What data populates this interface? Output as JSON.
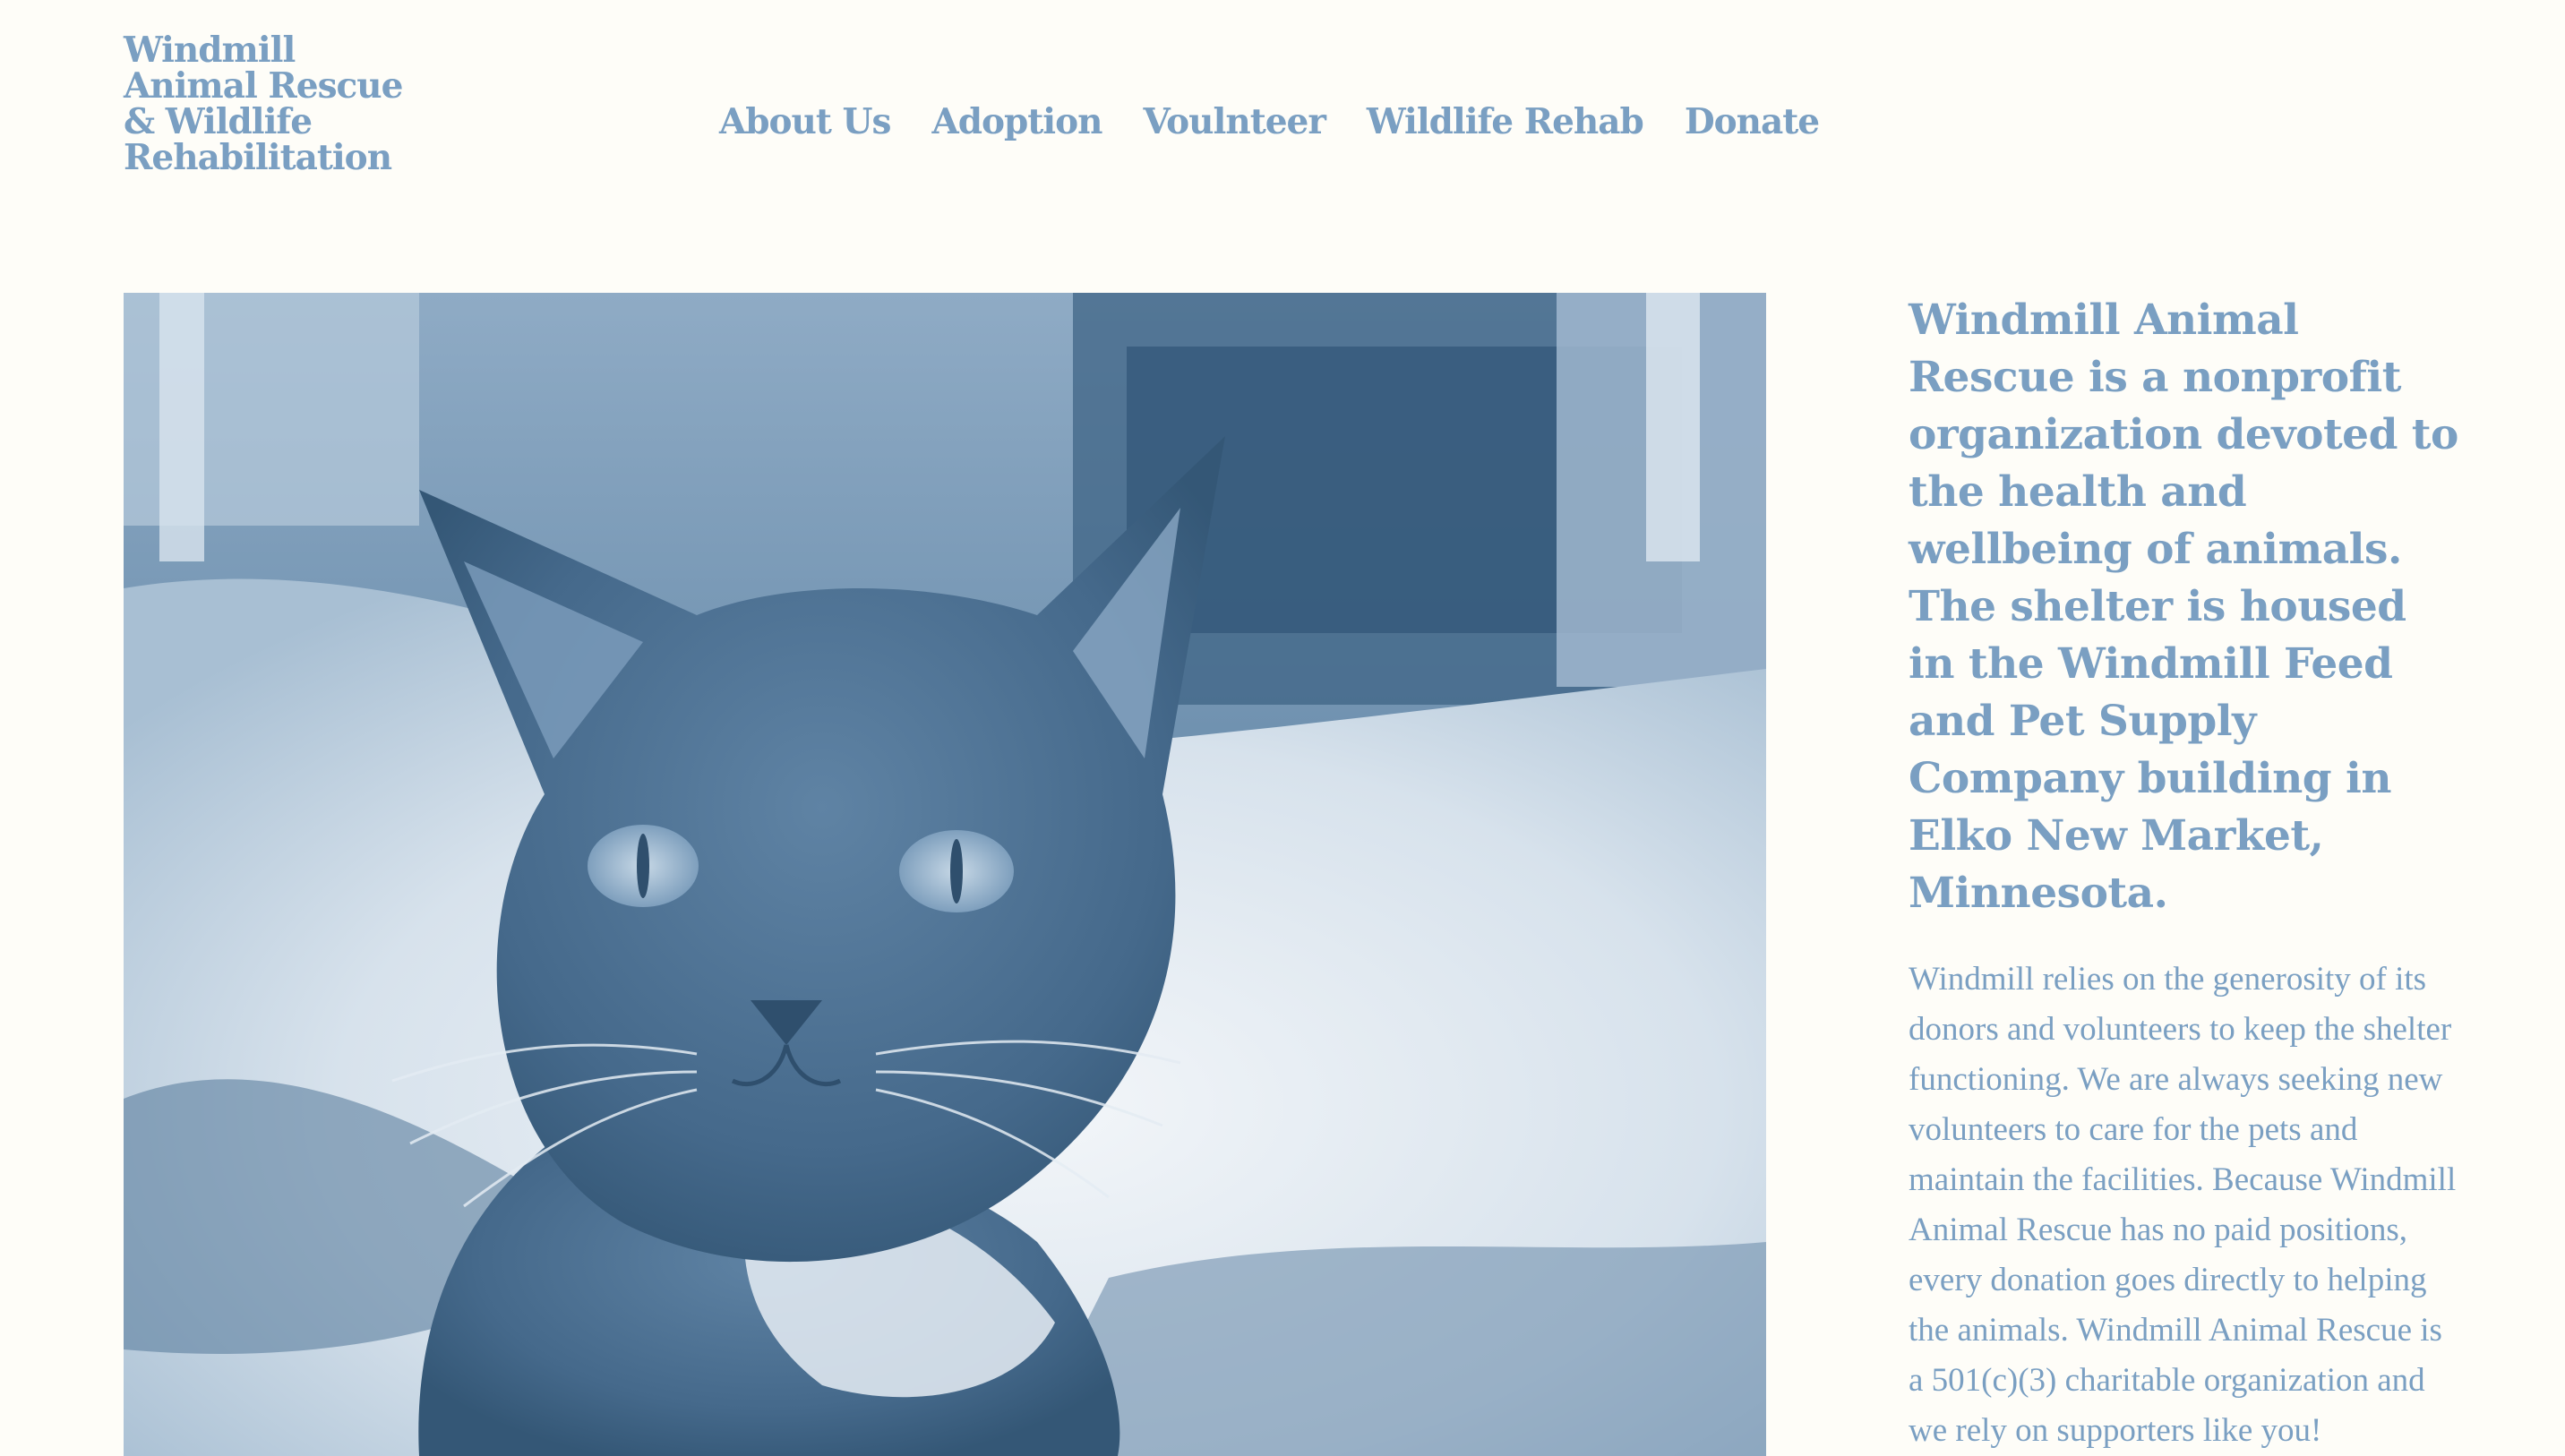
{
  "colors": {
    "background": "#fefdf8",
    "accent": "#7a9fc2",
    "photo_tint": "#4f7596"
  },
  "header": {
    "site_title_lines": [
      "Windmill",
      "Animal Rescue",
      "& Wildlife",
      "Rehabilitation"
    ]
  },
  "nav": {
    "items": [
      {
        "label": "About Us"
      },
      {
        "label": "Adoption"
      },
      {
        "label": "Voulnteer"
      },
      {
        "label": "Wildlife Rehab"
      },
      {
        "label": "Donate"
      }
    ]
  },
  "hero": {
    "image_subject": "duotone-blue photo of a young dark kitten on a white fluffy blanket"
  },
  "intro": {
    "heading": "Windmill Animal Rescue is a nonprofit organization devoted to the health and wellbeing of animals. The shelter is housed in the Windmill Feed and Pet Supply Company building in Elko New Market, Minnesota.",
    "body": "Windmill relies on the generosity of its donors and volunteers to keep the shelter functioning. We are always seeking new volunteers to care for the pets and maintain the facilities. Because Windmill Animal Rescue has no paid positions, every donation goes directly to helping the animals. Windmill Animal Rescue is a 501(c)(3) charitable organization and we rely on supporters like you!"
  }
}
